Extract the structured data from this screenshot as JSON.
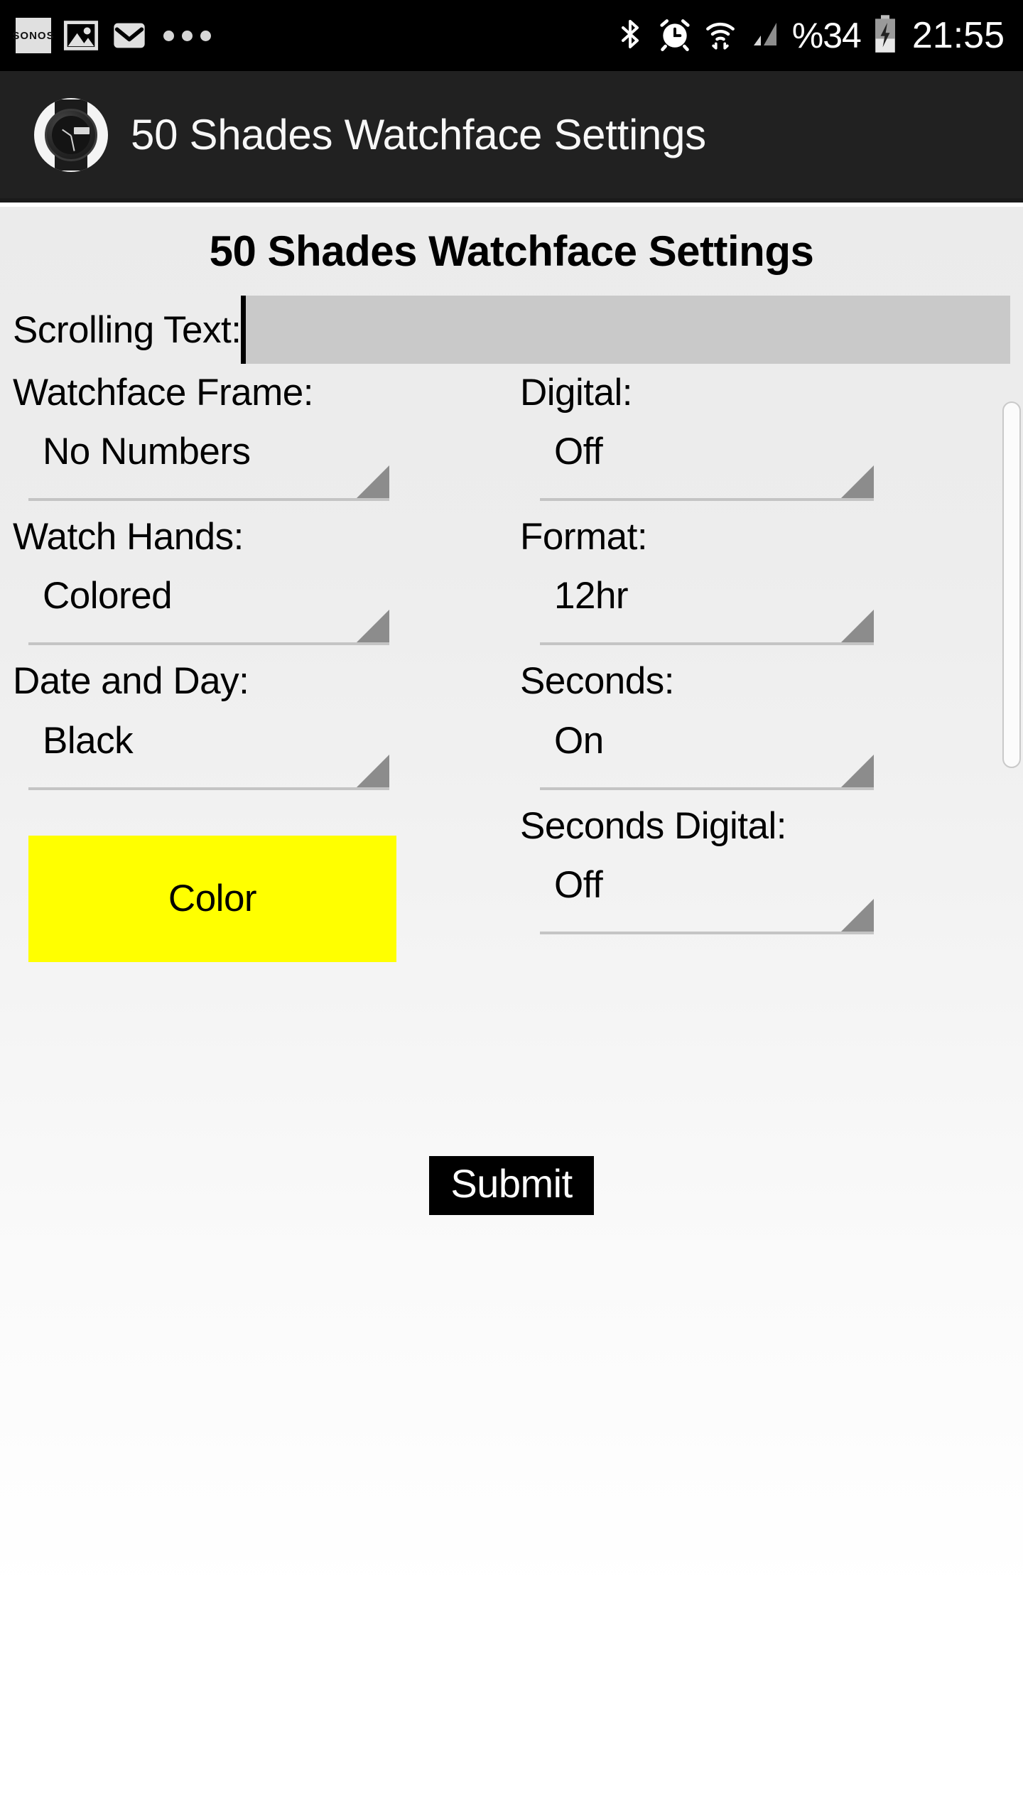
{
  "statusbar": {
    "notifications": [
      {
        "icon": "sonos-app-icon",
        "label": "SONOS"
      },
      {
        "icon": "photo-image-icon"
      },
      {
        "icon": "email-envelope-icon"
      },
      {
        "icon": "more-notifications-icon"
      }
    ],
    "indicators": [
      {
        "icon": "bluetooth-icon"
      },
      {
        "icon": "alarm-clock-icon"
      },
      {
        "icon": "wifi-icon"
      },
      {
        "icon": "cellular-signal-icon"
      }
    ],
    "battery_percent": "%34",
    "battery_icon": "battery-charging-icon",
    "clock": "21:55"
  },
  "appbar": {
    "icon": "watchface-app-icon",
    "title": "50 Shades Watchface Settings"
  },
  "page": {
    "title": "50 Shades Watchface Settings"
  },
  "scrolling_text": {
    "label": "Scrolling Text:",
    "value": "",
    "placeholder": ""
  },
  "left_column": [
    {
      "label": "Watchface Frame:",
      "value": "No Numbers",
      "name": "watchface-frame"
    },
    {
      "label": "Watch Hands:",
      "value": "Colored",
      "name": "watch-hands"
    },
    {
      "label": "Date and Day:",
      "value": "Black",
      "name": "date-and-day"
    }
  ],
  "right_column": [
    {
      "label": "Digital:",
      "value": "Off",
      "name": "digital"
    },
    {
      "label": "Format:",
      "value": "12hr",
      "name": "format"
    },
    {
      "label": "Seconds:",
      "value": "On",
      "name": "seconds"
    },
    {
      "label": "Seconds Digital:",
      "value": "Off",
      "name": "seconds-digital"
    }
  ],
  "color_button": {
    "label": "Color",
    "swatch": "#FFFF00"
  },
  "submit_button": {
    "label": "Submit"
  },
  "colors": {
    "appbar_bg": "#212121",
    "statusbar_bg": "#000000",
    "content_bg_top": "#EBEBEB",
    "content_bg_bottom": "#FFFFFF",
    "input_bg": "#C9C9C9",
    "spinner_underline": "#C4C4C4",
    "spinner_arrow": "#8C8C8C",
    "accent_yellow": "#FFFF00",
    "submit_bg": "#000000",
    "submit_text": "#FFFFFF"
  }
}
